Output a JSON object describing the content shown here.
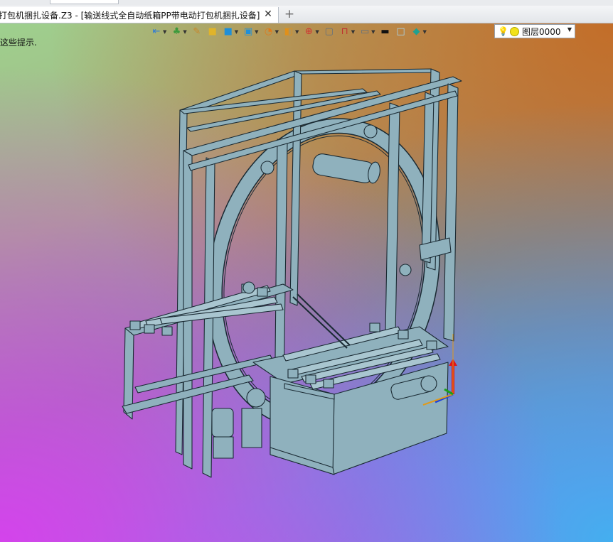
{
  "window": {
    "tab_title": "打包机捆扎设备.Z3 - [输送线式全自动纸箱PP带电动打包机捆扎设备]",
    "close_glyph": "✕",
    "add_glyph": "+"
  },
  "viewport": {
    "hint_text": "这些提示."
  },
  "toolbar": {
    "items": [
      {
        "name": "import-icon",
        "glyph": "⇤",
        "color": "#2e7bd6"
      },
      {
        "name": "material-icon",
        "glyph": "♣",
        "color": "#3c9a3c"
      },
      {
        "name": "brush-icon",
        "glyph": "✎",
        "color": "#c8862a"
      },
      {
        "name": "solid-yellow-icon",
        "glyph": "■",
        "color": "#e0b42a"
      },
      {
        "name": "cube-icon",
        "glyph": "■",
        "color": "#1f8fd8"
      },
      {
        "name": "cube-stack-icon",
        "glyph": "▣",
        "color": "#1f8fd8"
      },
      {
        "name": "pie-icon",
        "glyph": "◔",
        "color": "#e07a1a"
      },
      {
        "name": "view-icon",
        "glyph": "◧",
        "color": "#e0901a"
      },
      {
        "name": "axis-icon",
        "glyph": "⊕",
        "color": "#d03030"
      },
      {
        "name": "frame-icon",
        "glyph": "▢",
        "color": "#607080"
      },
      {
        "name": "dimension-icon",
        "glyph": "⊓",
        "color": "#c03030"
      },
      {
        "name": "monitor-icon",
        "glyph": "▭",
        "color": "#607080"
      },
      {
        "name": "line-color-icon",
        "glyph": "▬",
        "color": "#111111"
      },
      {
        "name": "fill-color-icon",
        "glyph": "□",
        "color": "#a8d8f0"
      },
      {
        "name": "layers-icon",
        "glyph": "◆",
        "color": "#20a090"
      }
    ]
  },
  "layer": {
    "name": "图层0000",
    "bulb_glyph": "💡"
  }
}
